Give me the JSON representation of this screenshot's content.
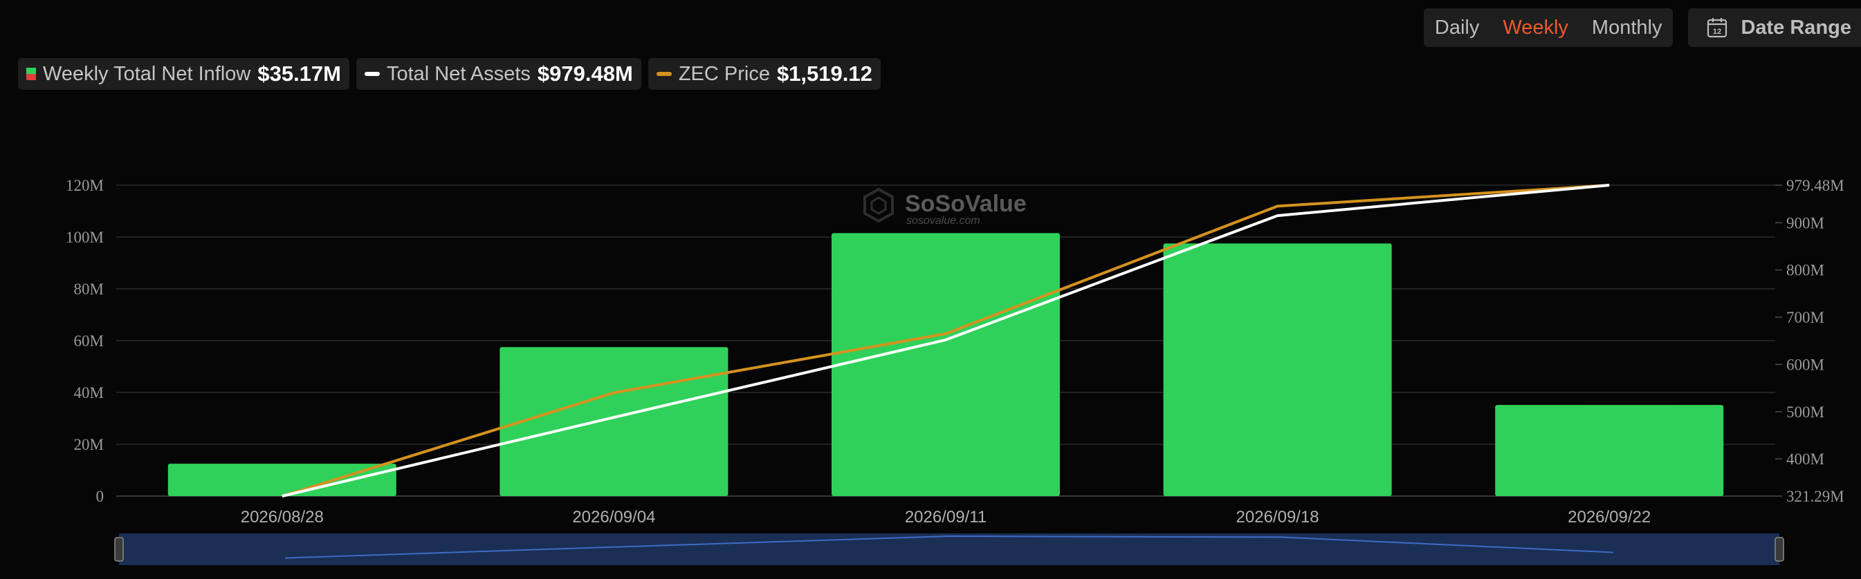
{
  "toolbar": {
    "periods": [
      {
        "label": "Daily",
        "active": false
      },
      {
        "label": "Weekly",
        "active": true
      },
      {
        "label": "Monthly",
        "active": false
      }
    ],
    "date_range_label": "Date Range",
    "calendar_day": "12"
  },
  "legend": [
    {
      "label": "Weekly Total Net Inflow",
      "value": "$35.17M",
      "icon": "bar-swatch",
      "colors": [
        "#2fd15a",
        "#e0403a"
      ]
    },
    {
      "label": "Total Net Assets",
      "value": "$979.48M",
      "icon": "line-swatch",
      "color": "#ffffff"
    },
    {
      "label": "ZEC Price",
      "value": "$1,519.12",
      "icon": "line-swatch",
      "color": "#d4921f"
    }
  ],
  "watermark": {
    "brand": "SoSoValue",
    "domain": "sosovalue.com"
  },
  "chart_data": {
    "type": "bar",
    "categories": [
      "2026/08/28",
      "2026/09/04",
      "2026/09/11",
      "2026/09/18",
      "2026/09/22"
    ],
    "series": [
      {
        "type": "bar",
        "axis": "left",
        "color": "#2fd15a",
        "values": [
          12.5,
          57.5,
          101.5,
          97.5,
          35.17
        ]
      },
      {
        "type": "line",
        "axis": "right",
        "color": "#ffffff",
        "values": [
          321.29,
          488,
          652,
          915,
          979.48
        ]
      },
      {
        "type": "line",
        "axis": "right",
        "color": "#d4921f",
        "values": [
          321.29,
          540,
          665,
          935,
          979.48
        ]
      }
    ],
    "y_left": {
      "ticks": [
        0,
        20,
        40,
        60,
        80,
        100,
        120
      ],
      "tick_labels": [
        "0",
        "20M",
        "40M",
        "60M",
        "80M",
        "100M",
        "120M"
      ],
      "range": [
        0,
        120
      ]
    },
    "y_right": {
      "ticks": [
        321.29,
        400,
        500,
        600,
        700,
        800,
        900,
        979.48
      ],
      "tick_labels": [
        "321.29M",
        "400M",
        "500M",
        "600M",
        "700M",
        "800M",
        "900M",
        "979.48M"
      ],
      "range": [
        321.29,
        979.48
      ]
    },
    "grid": true,
    "navigator": {
      "values": [
        12.5,
        57.5,
        101.5,
        97.5,
        35.17
      ]
    }
  }
}
